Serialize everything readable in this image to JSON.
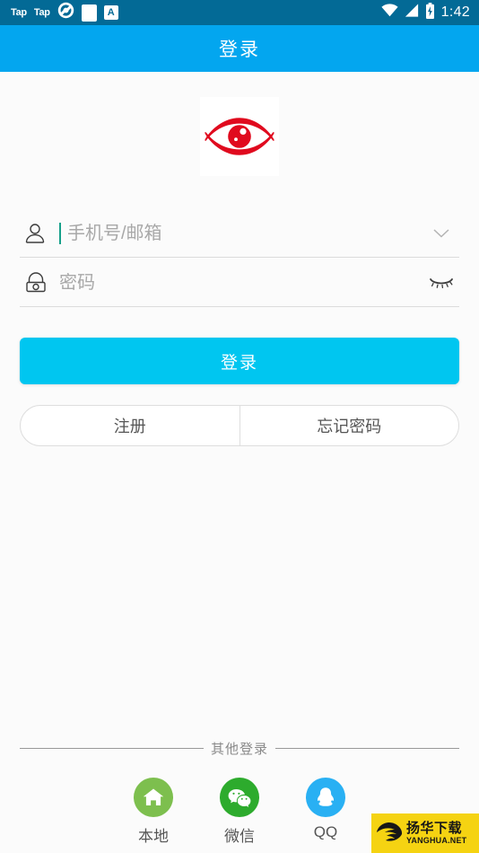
{
  "statusbar": {
    "app_tag_1": "Tap",
    "app_tag_2": "Tap",
    "icons": [
      "tap-logo-icon",
      "white-square-icon",
      "a-badge-icon",
      "wifi-icon",
      "cellular-signal-icon",
      "battery-charging-icon"
    ],
    "a_badge_letter": "A",
    "time": "1:42",
    "background_color": "#036a96"
  },
  "header": {
    "title": "登录",
    "background_color": "#03a6ef",
    "text_color": "#ffffff"
  },
  "logo": {
    "name": "red-eye-logo",
    "color": "#e00a1e",
    "background_color": "#ffffff"
  },
  "form": {
    "username": {
      "icon": "person-icon",
      "placeholder": "手机号/邮箱",
      "value": "",
      "caret_color": "#17a08a",
      "right_icon": "chevron-down-icon"
    },
    "password": {
      "icon": "lock-icon",
      "placeholder": "密码",
      "value": "",
      "right_icon": "eye-closed-icon"
    }
  },
  "actions": {
    "login_label": "登录",
    "login_color": "#00c6f0",
    "register_label": "注册",
    "forgot_label": "忘记密码"
  },
  "other_login": {
    "divider_label": "其他登录",
    "items": [
      {
        "label": "本地",
        "icon": "home-icon",
        "color": "#7dbf4e"
      },
      {
        "label": "微信",
        "icon": "wechat-icon",
        "color": "#2dab2d"
      },
      {
        "label": "QQ",
        "icon": "qq-penguin-icon",
        "color": "#29b0f3"
      }
    ]
  },
  "watermark": {
    "cn": "扬华下载",
    "en": "YANGHUA.NET",
    "background_color": "#f5d312"
  }
}
